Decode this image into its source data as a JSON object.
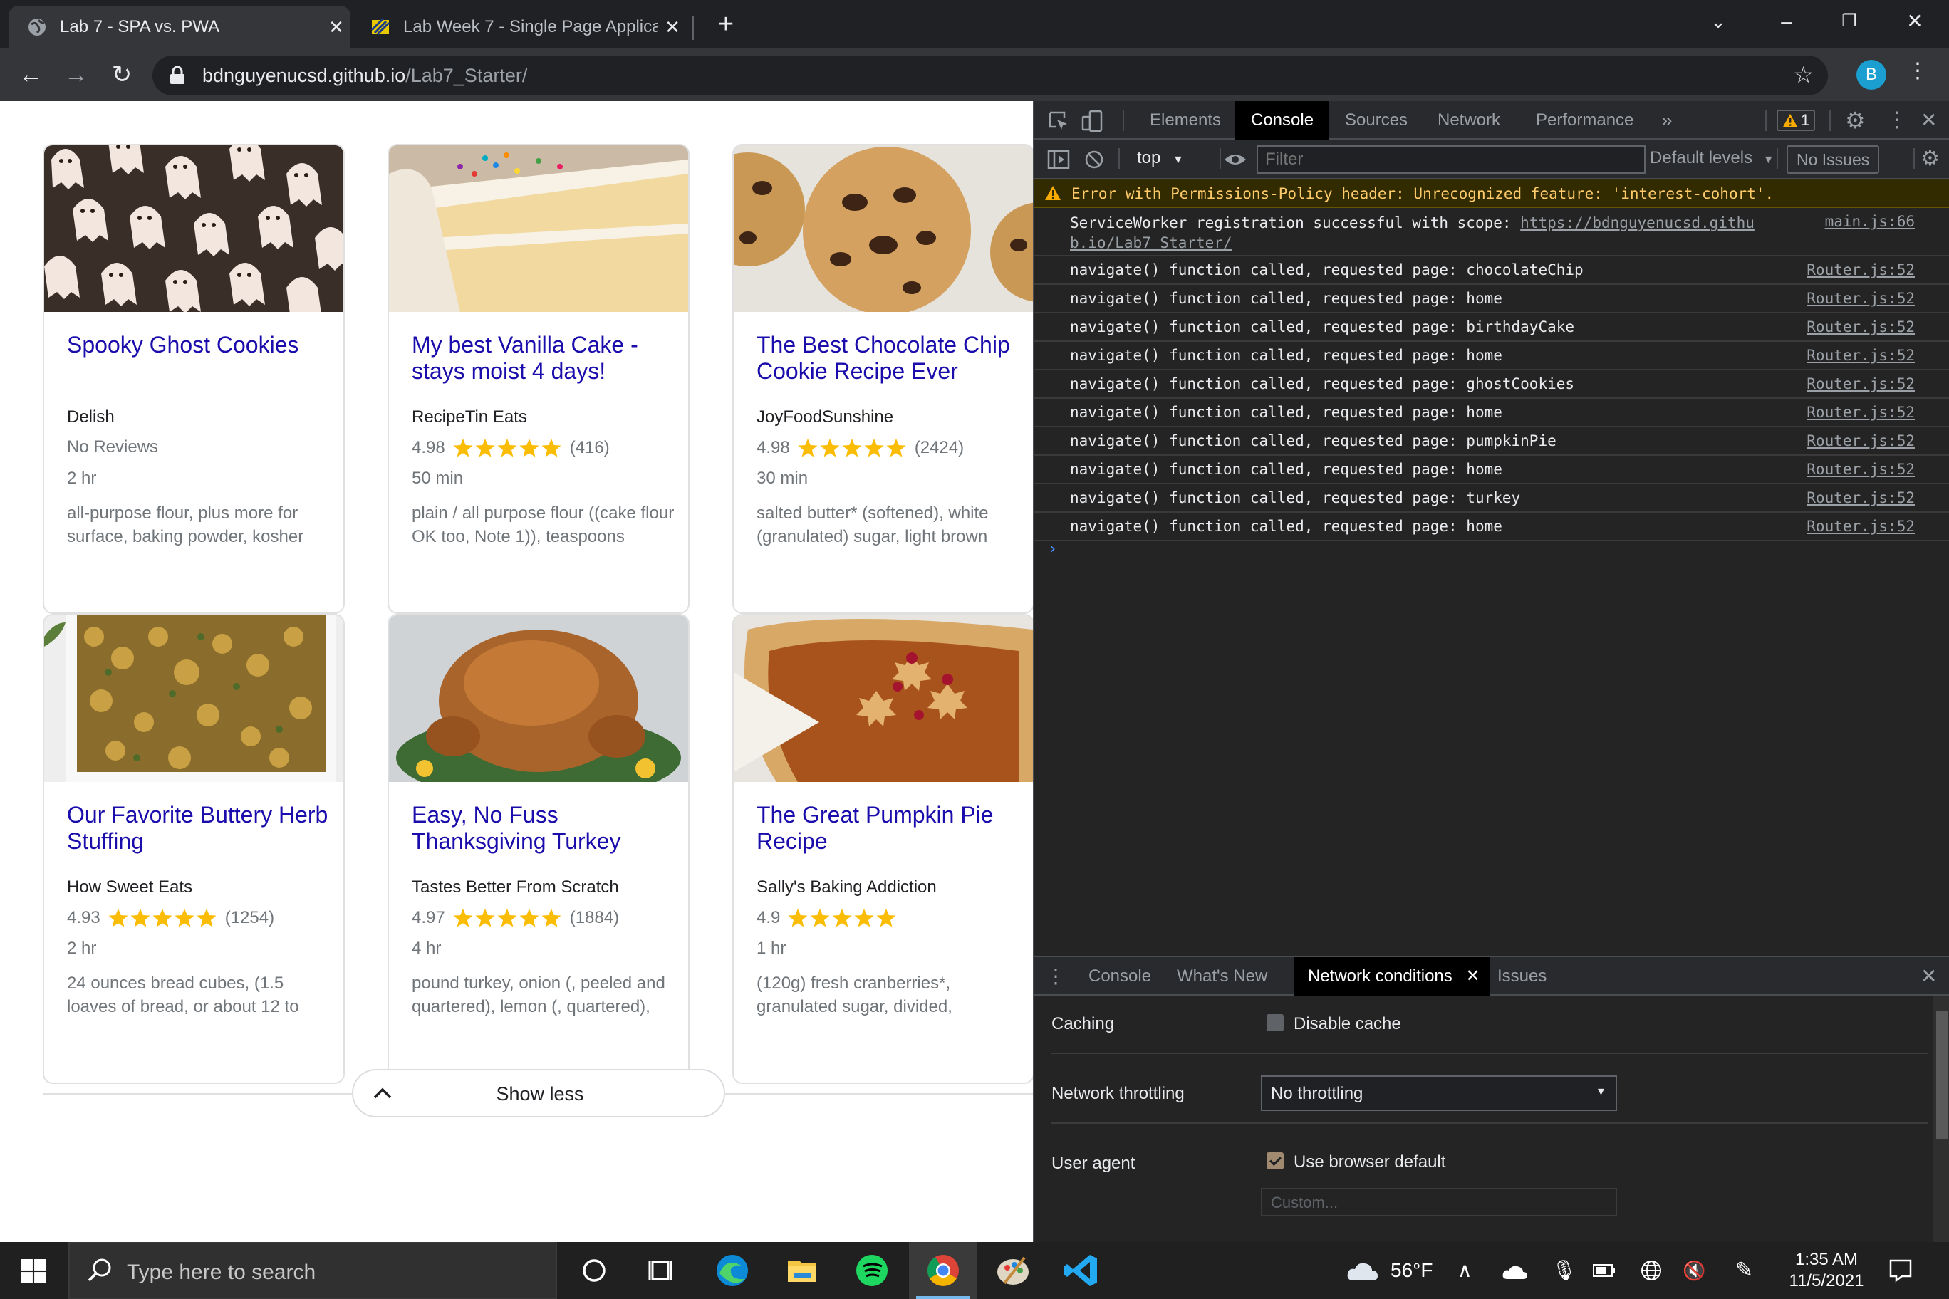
{
  "browser": {
    "tabs": [
      {
        "title": "Lab 7 - SPA vs. PWA"
      },
      {
        "title": "Lab Week 7 - Single Page Applica"
      }
    ],
    "url_host": "bdnguyenucsd.github.io",
    "url_path": "/Lab7_Starter/",
    "profile_initial": "B"
  },
  "page": {
    "cards": [
      {
        "title": "Spooky Ghost Cookies",
        "org": "Delish",
        "score": "",
        "count": "",
        "no_reviews": "No Reviews",
        "time": "2 hr",
        "ingredients": "all-purpose flour, plus more for surface, baking powder, kosher"
      },
      {
        "title": "My best Vanilla Cake - stays moist 4 days!",
        "org": "RecipeTin Eats",
        "score": "4.98",
        "count": "(416)",
        "time": "50 min",
        "ingredients": "plain / all purpose flour ((cake flour OK too, Note 1)), teaspoons"
      },
      {
        "title": "The Best Chocolate Chip Cookie Recipe Ever",
        "org": "JoyFoodSunshine",
        "score": "4.98",
        "count": "(2424)",
        "time": "30 min",
        "ingredients": "salted butter* (softened), white (granulated) sugar, light brown"
      },
      {
        "title": "Our Favorite Buttery Herb Stuffing",
        "org": "How Sweet Eats",
        "score": "4.93",
        "count": "(1254)",
        "time": "2 hr",
        "ingredients": "24 ounces bread cubes, (1.5 loaves of bread, or about 12 to"
      },
      {
        "title": "Easy, No Fuss Thanksgiving Turkey",
        "org": "Tastes Better From Scratch",
        "score": "4.97",
        "count": "(1884)",
        "time": "4 hr",
        "ingredients": "pound turkey, onion (, peeled and quartered), lemon (, quartered),"
      },
      {
        "title": "The Great Pumpkin Pie Recipe",
        "org": "Sally's Baking Addiction",
        "score": "4.9",
        "count": "",
        "time": "1 hr",
        "ingredients": "(120g) fresh cranberries*, granulated sugar, divided,"
      }
    ],
    "show_less": "Show less"
  },
  "devtools": {
    "tabs": [
      "Elements",
      "Console",
      "Sources",
      "Network",
      "Performance"
    ],
    "active_tab": "Console",
    "warning_count": "1",
    "context": "top",
    "filter_placeholder": "Filter",
    "levels": "Default levels",
    "issues": "No Issues",
    "warning": "Error with Permissions-Policy header: Unrecognized feature: 'interest-cohort'.",
    "sw_message": "ServiceWorker registration successful with scope:",
    "sw_link_1": "https://bdnguyenucsd.githu",
    "sw_link_2": "b.io/Lab7_Starter/",
    "sw_source": "main.js:66",
    "log_prefix": "navigate() function called, requested page: ",
    "log_source": "Router.js:52",
    "logs": [
      "chocolateChip",
      "home",
      "birthdayCake",
      "home",
      "ghostCookies",
      "home",
      "pumpkinPie",
      "home",
      "turkey",
      "home"
    ],
    "drawer_tabs": [
      "Console",
      "What's New",
      "Network conditions",
      "Issues"
    ],
    "network_conditions": {
      "caching_label": "Caching",
      "disable_cache": "Disable cache",
      "throttling_label": "Network throttling",
      "throttling_value": "No throttling",
      "ua_label": "User agent",
      "ua_default": "Use browser default",
      "custom_placeholder": "Custom..."
    }
  },
  "taskbar": {
    "search_placeholder": "Type here to search",
    "weather": "56°F",
    "time": "1:35 AM",
    "date": "11/5/2021"
  },
  "colors": {
    "link": "#1a0dab",
    "star": "#fbbc04",
    "warning": "#ffcb6b",
    "devtools_bg": "#242424"
  }
}
